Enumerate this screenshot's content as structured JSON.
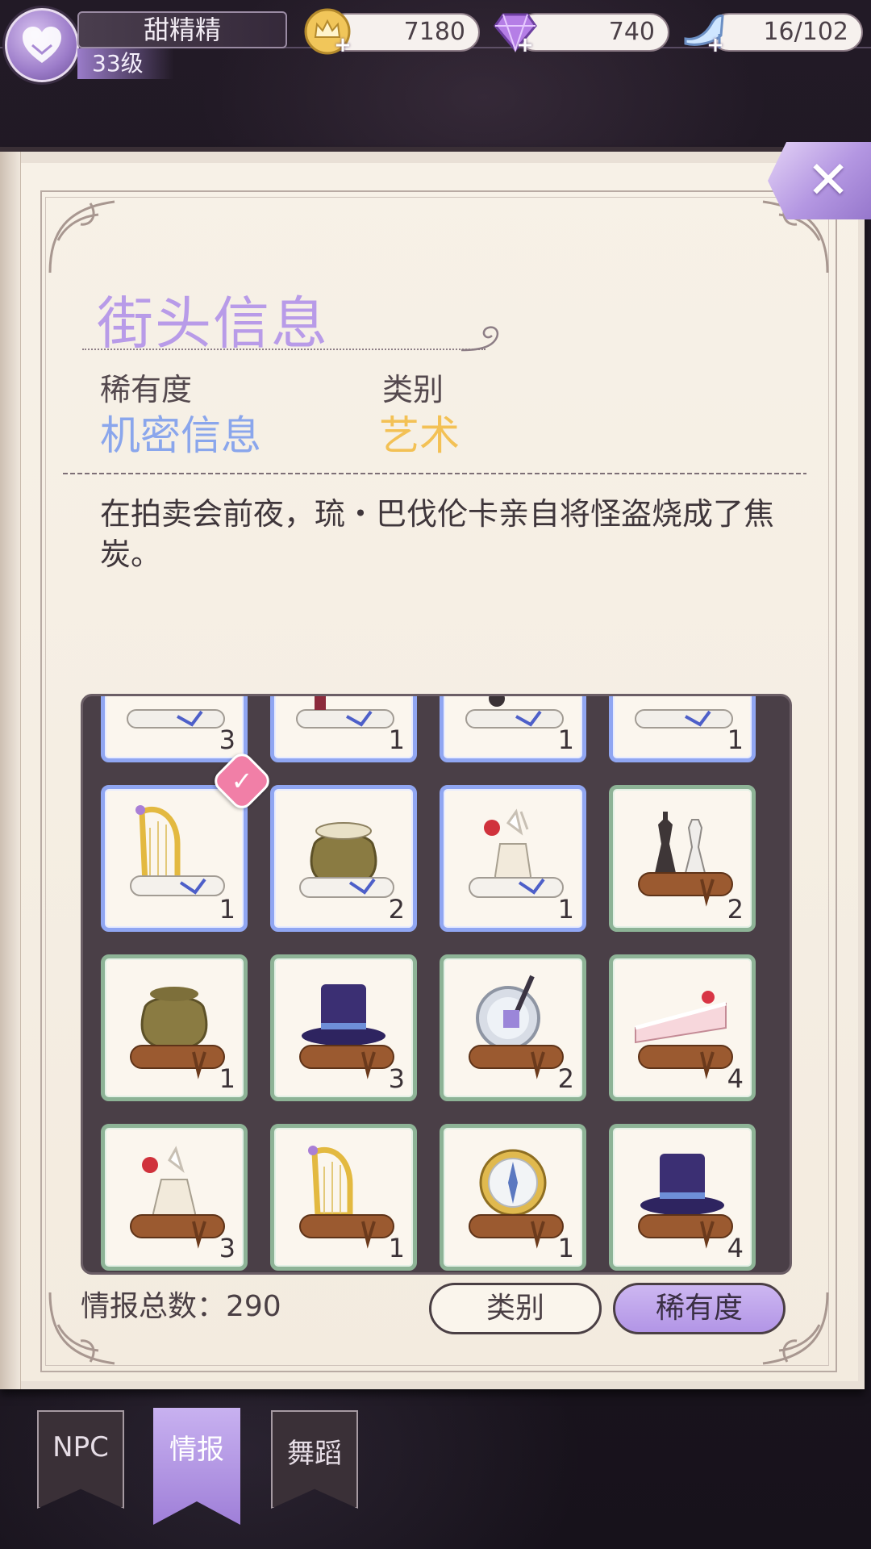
{
  "player": {
    "name": "甜精精",
    "level": "33级"
  },
  "resources": [
    {
      "icon": "crown-coin-icon",
      "value": "7180"
    },
    {
      "icon": "purple-diamond-icon",
      "value": "740"
    },
    {
      "icon": "glass-slipper-icon",
      "value": "16/102"
    }
  ],
  "detail": {
    "title": "街头信息",
    "rarity_label": "稀有度",
    "rarity_value": "机密信息",
    "category_label": "类别",
    "category_value": "艺术",
    "description": "在拍卖会前夜，琉・巴伐伦卡亲自将怪盗烧成了焦炭。"
  },
  "colors": {
    "title": "#b89be8",
    "rarity_value": "#8aa6ec",
    "category_value": "#f3c155",
    "rare_border": "#90a6f2",
    "common_border": "#8db396",
    "active_tab": "#b497e2"
  },
  "grid": {
    "rows": [
      [
        {
          "item": "scroll-item",
          "rarity": "rare",
          "count": "3"
        },
        {
          "item": "scroll-item",
          "rarity": "rare",
          "count": "1"
        },
        {
          "item": "scroll-item",
          "rarity": "rare",
          "count": "1"
        },
        {
          "item": "scroll-item",
          "rarity": "rare",
          "count": "1"
        }
      ],
      [
        {
          "item": "harp-scroll",
          "rarity": "rare",
          "count": "1",
          "selected": true
        },
        {
          "item": "sack-scroll",
          "rarity": "rare",
          "count": "2"
        },
        {
          "item": "vase-scroll",
          "rarity": "rare",
          "count": "1"
        },
        {
          "item": "chess-scroll",
          "rarity": "common",
          "count": "2"
        }
      ],
      [
        {
          "item": "sack-scroll",
          "rarity": "common",
          "count": "1"
        },
        {
          "item": "top-hat-scroll",
          "rarity": "common",
          "count": "3"
        },
        {
          "item": "mirror-sword-scroll",
          "rarity": "common",
          "count": "2"
        },
        {
          "item": "cake-scroll",
          "rarity": "common",
          "count": "4"
        }
      ],
      [
        {
          "item": "vase-scroll",
          "rarity": "common",
          "count": "3"
        },
        {
          "item": "harp-scroll",
          "rarity": "common",
          "count": "1"
        },
        {
          "item": "compass-scroll",
          "rarity": "common",
          "count": "1"
        },
        {
          "item": "top-hat-scroll",
          "rarity": "common",
          "count": "4"
        }
      ]
    ]
  },
  "footer": {
    "total_label": "情报总数：290",
    "category_button": "类别",
    "rarity_button": "稀有度"
  },
  "tabs": [
    {
      "label": "NPC",
      "active": false
    },
    {
      "label": "情报",
      "active": true
    },
    {
      "label": "舞蹈",
      "active": false
    }
  ]
}
